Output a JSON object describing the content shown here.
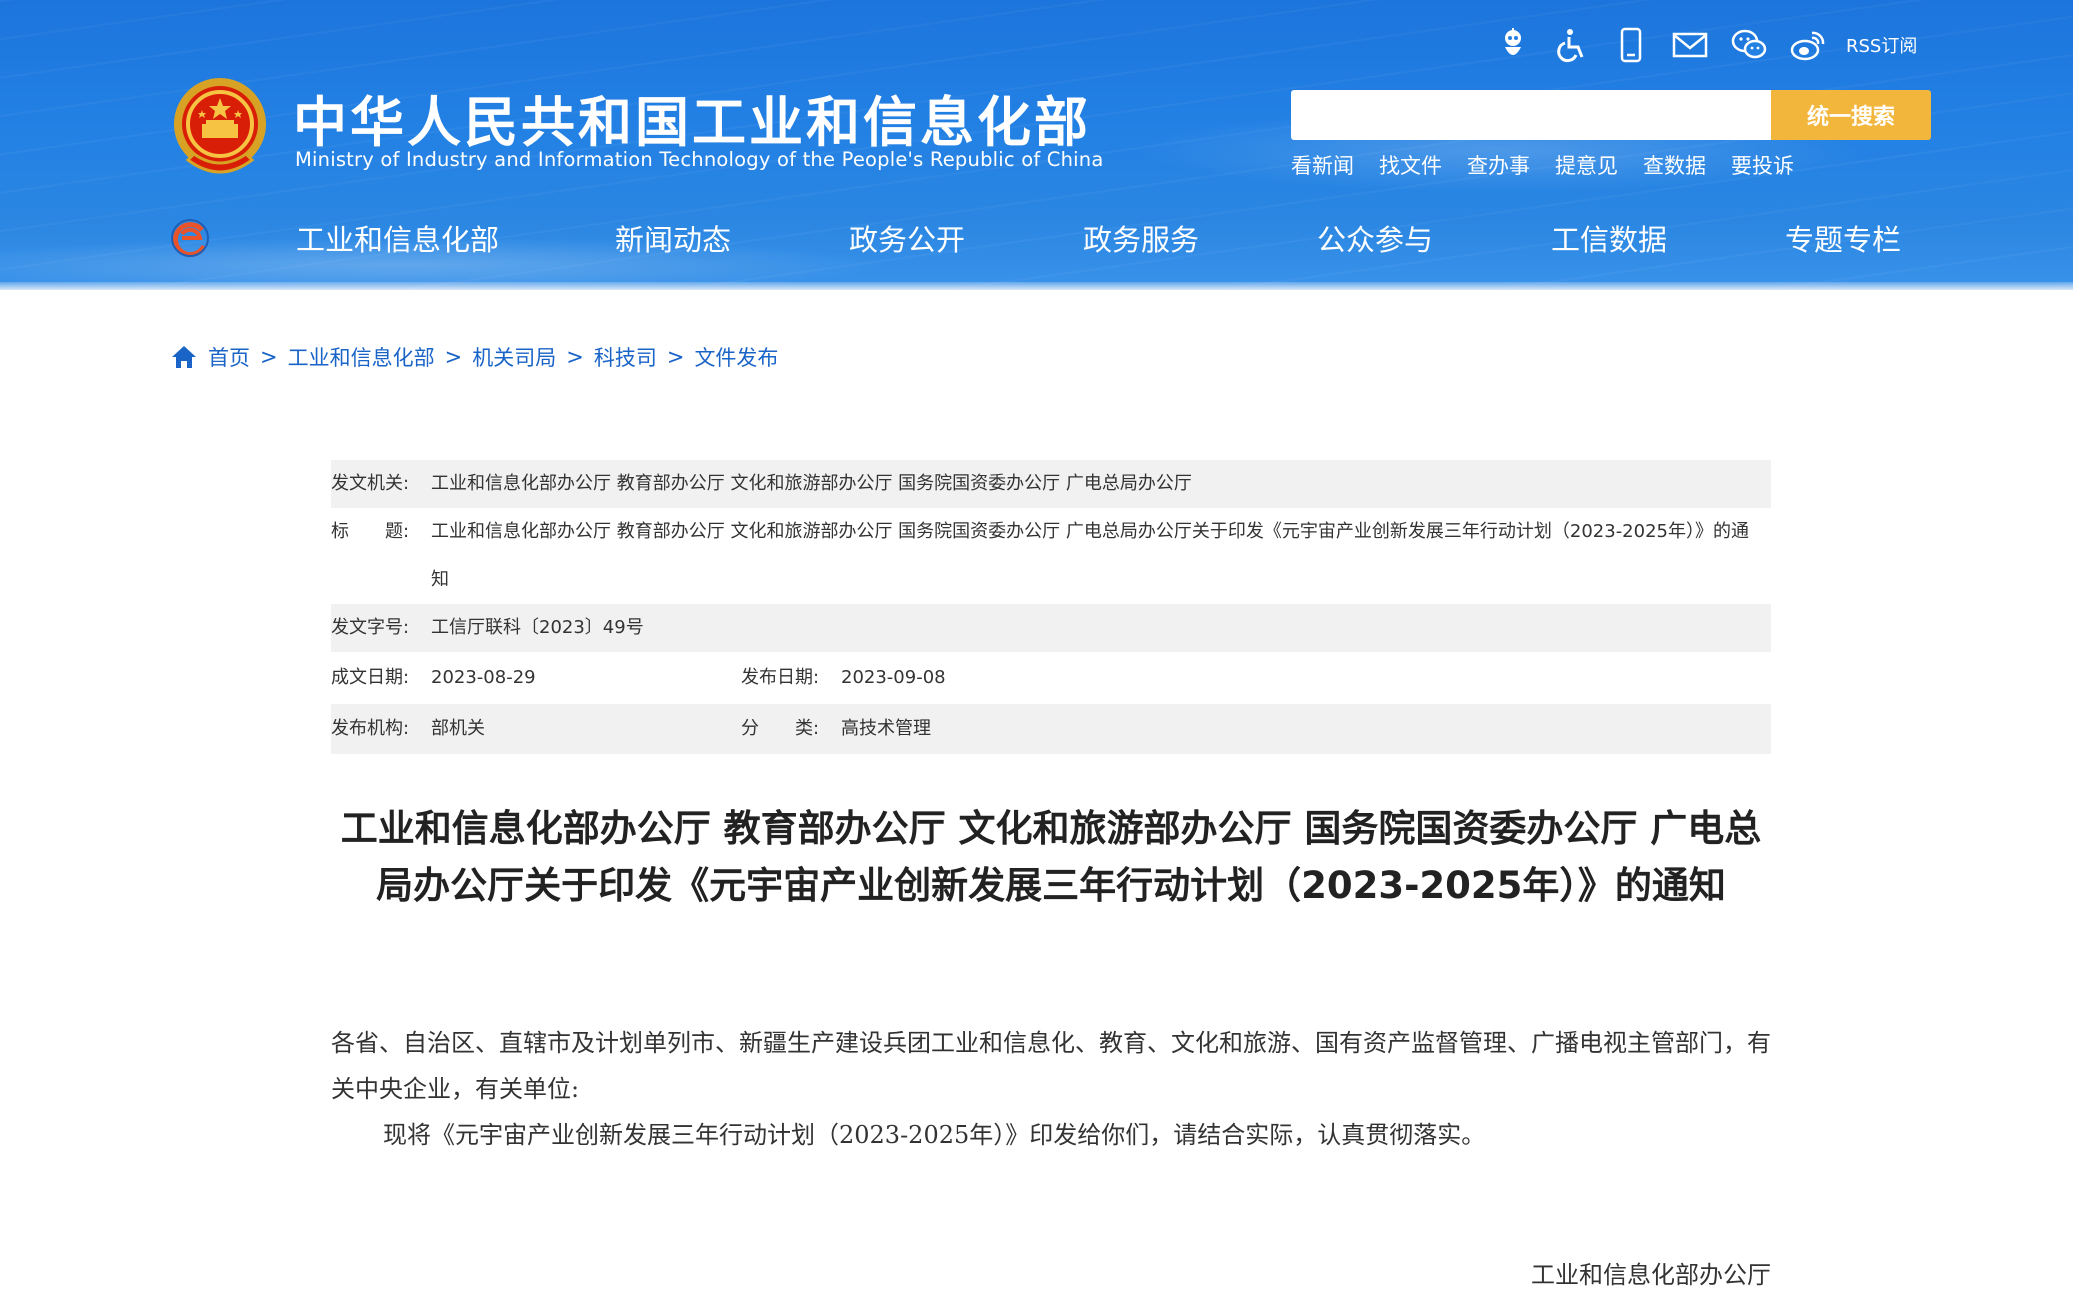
{
  "header": {
    "title": "中华人民共和国工业和信息化部",
    "subtitle": "Ministry of Industry and Information Technology of the People's Republic of China",
    "tools": [
      {
        "icon": "robot-icon"
      },
      {
        "icon": "accessibility-icon"
      },
      {
        "icon": "mobile-icon"
      },
      {
        "icon": "mail-icon"
      },
      {
        "icon": "wechat-icon"
      },
      {
        "icon": "weibo-icon"
      }
    ],
    "rss_label": "RSS订阅",
    "search": {
      "placeholder": "",
      "button_label": "统一搜索"
    },
    "quick_links": [
      "看新闻",
      "找文件",
      "查办事",
      "提意见",
      "查数据",
      "要投诉"
    ],
    "nav": [
      "工业和信息化部",
      "新闻动态",
      "政务公开",
      "政务服务",
      "公众参与",
      "工信数据",
      "专题专栏"
    ]
  },
  "breadcrumb": [
    "首页",
    "工业和信息化部",
    "机关司局",
    "科技司",
    "文件发布"
  ],
  "breadcrumb_sep": ">",
  "meta": {
    "issuer_label": "发文机关:",
    "issuer": "工业和信息化部办公厅 教育部办公厅 文化和旅游部办公厅 国务院国资委办公厅 广电总局办公厅",
    "title_label": "标　　题:",
    "title": "工业和信息化部办公厅 教育部办公厅 文化和旅游部办公厅 国务院国资委办公厅 广电总局办公厅关于印发《元宇宙产业创新发展三年行动计划（2023-2025年）》的通知",
    "doc_no_label": "发文字号:",
    "doc_no": "工信厅联科〔2023〕49号",
    "written_date_label": "成文日期:",
    "written_date": "2023-08-29",
    "publish_date_label": "发布日期:",
    "publish_date": "2023-09-08",
    "publisher_label": "发布机构:",
    "publisher": "部机关",
    "category_label": "分　　类:",
    "category": "高技术管理"
  },
  "article": {
    "title": "工业和信息化部办公厅 教育部办公厅 文化和旅游部办公厅 国务院国资委办公厅 广电总局办公厅关于印发《元宇宙产业创新发展三年行动计划（2023-2025年）》的通知",
    "salutation": "各省、自治区、直辖市及计划单列市、新疆生产建设兵团工业和信息化、教育、文化和旅游、国有资产监督管理、广播电视主管部门，有关中央企业，有关单位:",
    "paragraph1": "现将《元宇宙产业创新发展三年行动计划（2023-2025年）》印发给你们，请结合实际，认真贯彻落实。",
    "signature": "工业和信息化部办公厅"
  },
  "colors": {
    "header_blue": "#2381e4",
    "search_button": "#f3b63c",
    "link_blue": "#1a64c8",
    "row_shade": "#f1f1f1"
  }
}
